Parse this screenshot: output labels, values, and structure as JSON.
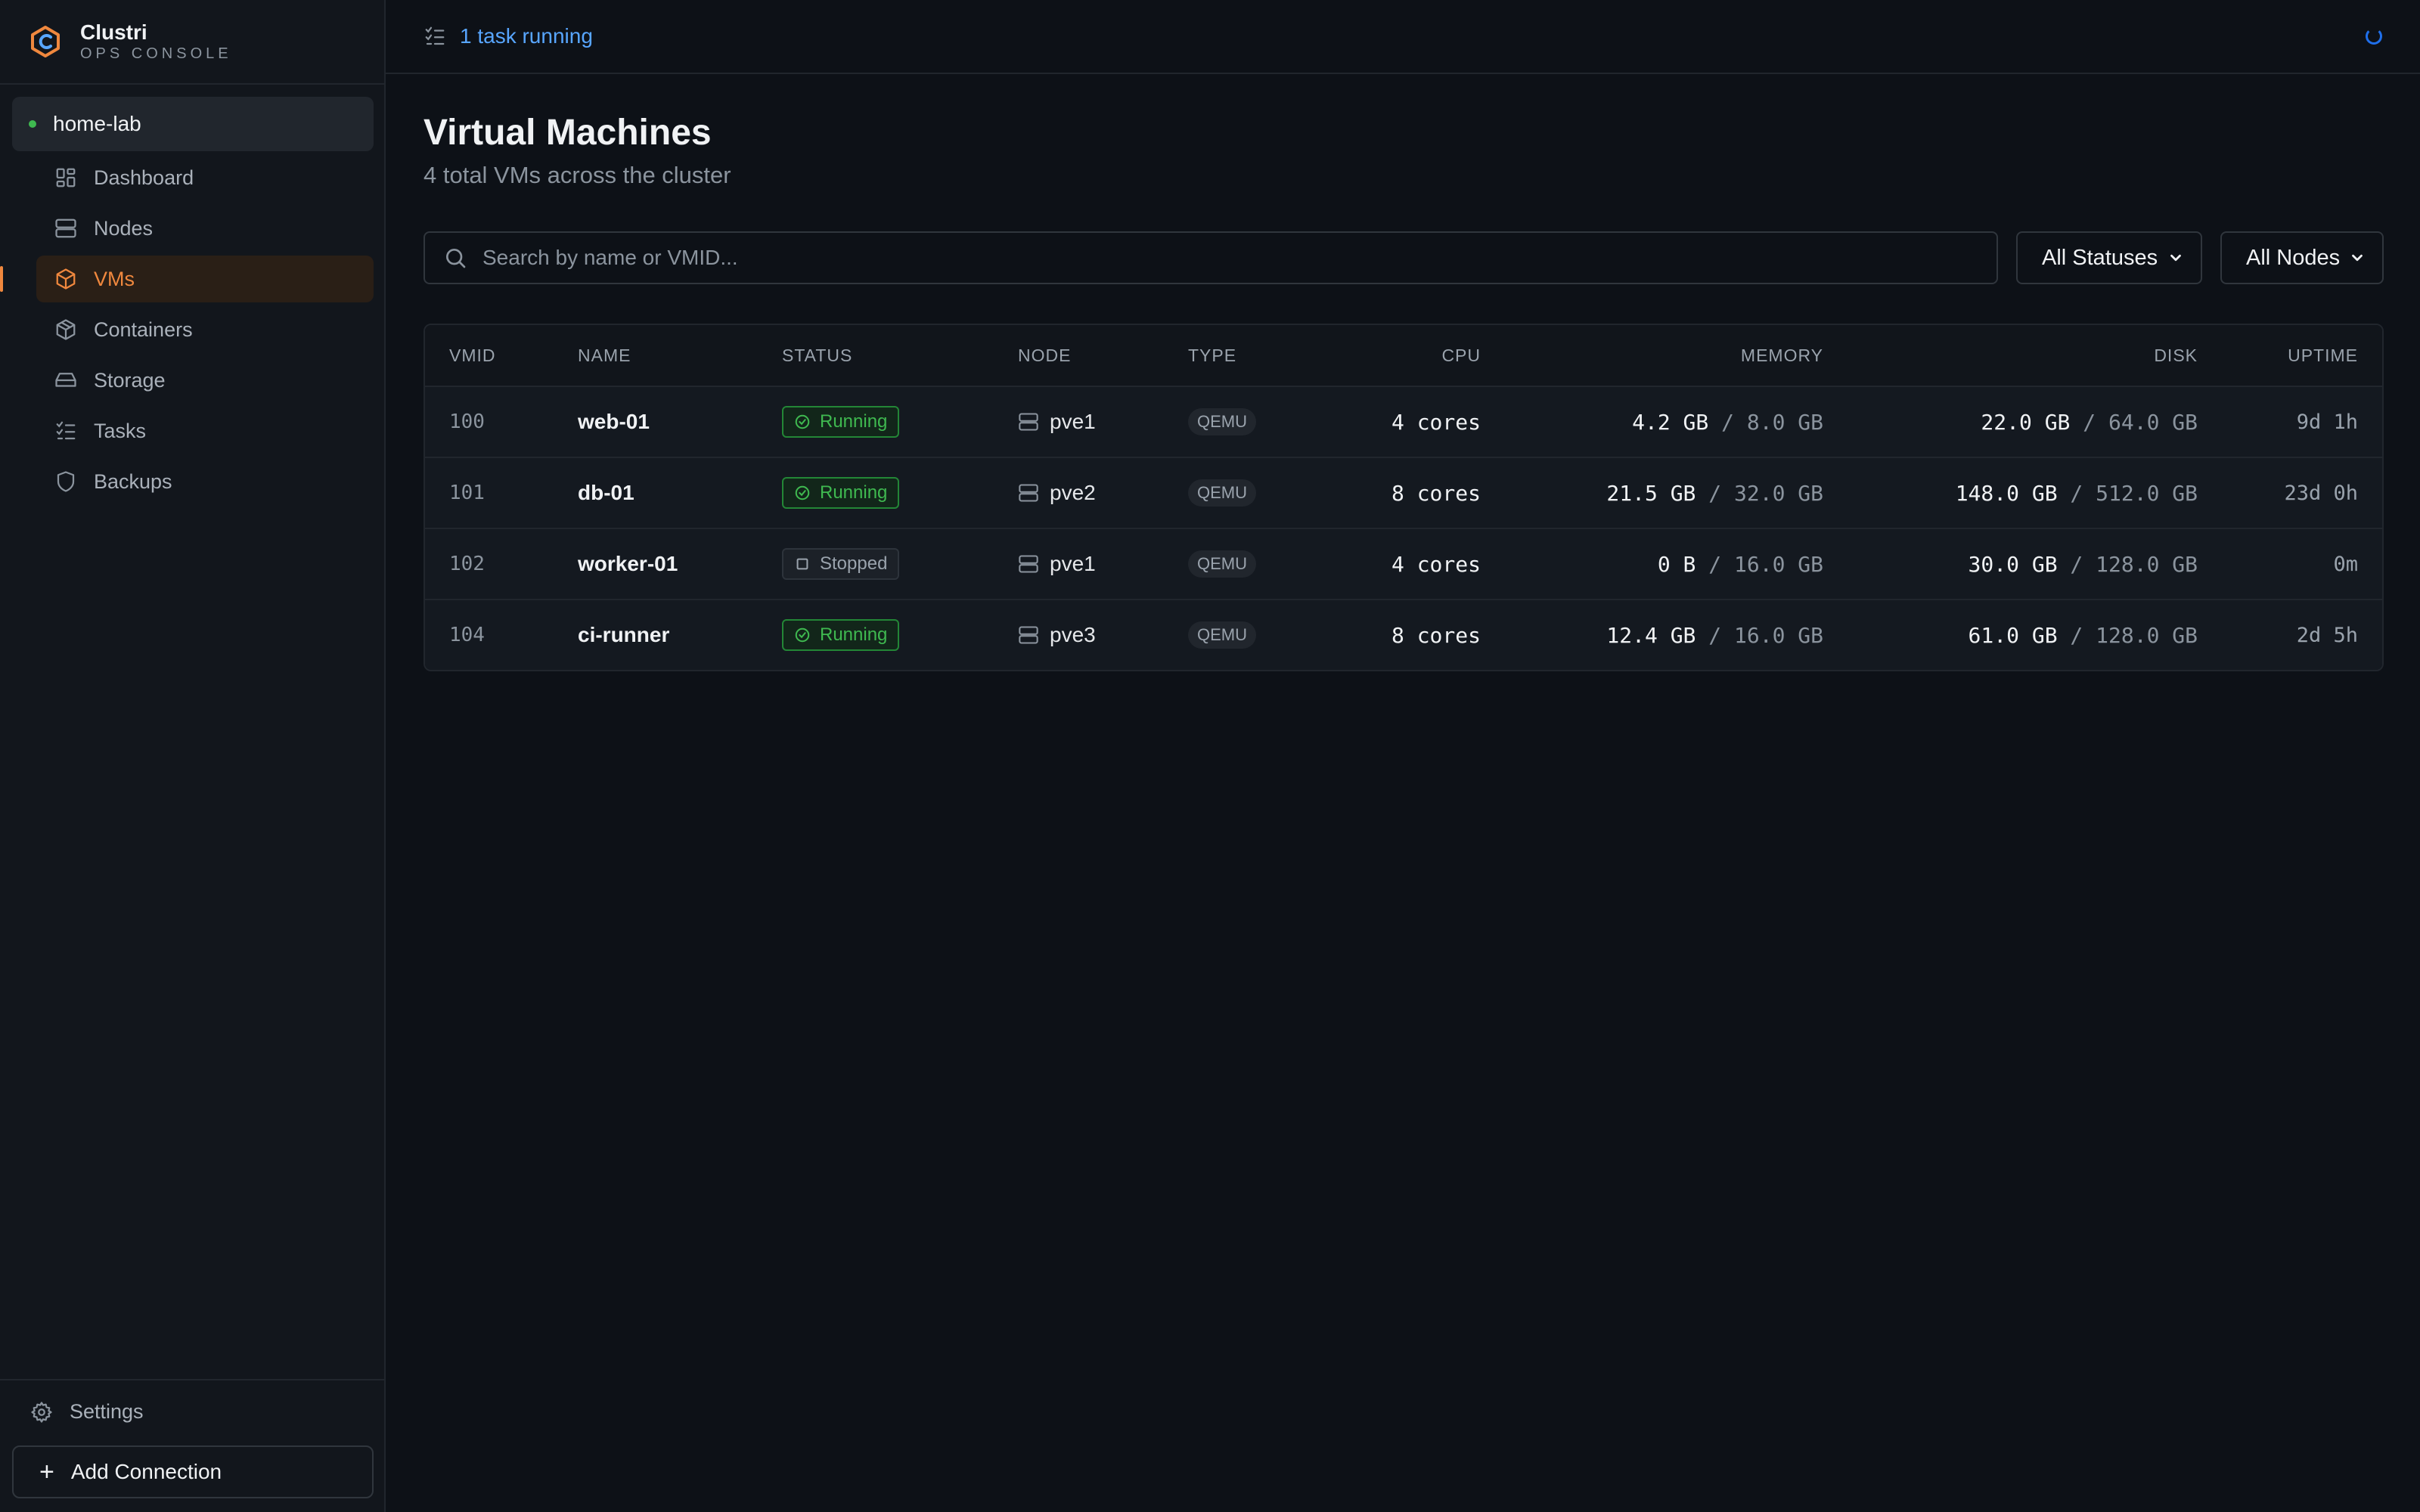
{
  "brand": {
    "name": "Clustri",
    "subtitle": "OPS CONSOLE"
  },
  "connection": {
    "name": "home-lab",
    "status_color": "#3fb950"
  },
  "nav": [
    {
      "label": "Dashboard",
      "icon": "dashboard-icon"
    },
    {
      "label": "Nodes",
      "icon": "server-icon"
    },
    {
      "label": "VMs",
      "icon": "cube-icon",
      "active": true
    },
    {
      "label": "Containers",
      "icon": "box-icon"
    },
    {
      "label": "Storage",
      "icon": "hard-drive-icon"
    },
    {
      "label": "Tasks",
      "icon": "list-checks-icon"
    },
    {
      "label": "Backups",
      "icon": "shield-icon"
    }
  ],
  "footer": {
    "settings_label": "Settings",
    "add_connection_label": "Add Connection"
  },
  "topbar": {
    "tasks_label": "1 task running"
  },
  "page": {
    "title": "Virtual Machines",
    "subtitle": "4 total VMs across the cluster"
  },
  "filters": {
    "search_placeholder": "Search by name or VMID...",
    "status_select": "All Statuses",
    "node_select": "All Nodes"
  },
  "table": {
    "headers": {
      "vmid": "VMID",
      "name": "NAME",
      "status": "STATUS",
      "node": "NODE",
      "type": "TYPE",
      "cpu": "CPU",
      "memory": "MEMORY",
      "disk": "DISK",
      "uptime": "UPTIME"
    },
    "rows": [
      {
        "vmid": "100",
        "name": "web-01",
        "status": "Running",
        "status_kind": "running",
        "node": "pve1",
        "type": "QEMU",
        "cpu": "4 cores",
        "mem_used": "4.2 GB",
        "mem_total": "/ 8.0 GB",
        "disk_used": "22.0 GB",
        "disk_total": "/ 64.0 GB",
        "uptime": "9d 1h"
      },
      {
        "vmid": "101",
        "name": "db-01",
        "status": "Running",
        "status_kind": "running",
        "node": "pve2",
        "type": "QEMU",
        "cpu": "8 cores",
        "mem_used": "21.5 GB",
        "mem_total": "/ 32.0 GB",
        "disk_used": "148.0 GB",
        "disk_total": "/ 512.0 GB",
        "uptime": "23d 0h"
      },
      {
        "vmid": "102",
        "name": "worker-01",
        "status": "Stopped",
        "status_kind": "stopped",
        "node": "pve1",
        "type": "QEMU",
        "cpu": "4 cores",
        "mem_used": "0 B",
        "mem_total": "/ 16.0 GB",
        "disk_used": "30.0 GB",
        "disk_total": "/ 128.0 GB",
        "uptime": "0m"
      },
      {
        "vmid": "104",
        "name": "ci-runner",
        "status": "Running",
        "status_kind": "running",
        "node": "pve3",
        "type": "QEMU",
        "cpu": "8 cores",
        "mem_used": "12.4 GB",
        "mem_total": "/ 16.0 GB",
        "disk_used": "61.0 GB",
        "disk_total": "/ 128.0 GB",
        "uptime": "2d 5h"
      }
    ]
  }
}
